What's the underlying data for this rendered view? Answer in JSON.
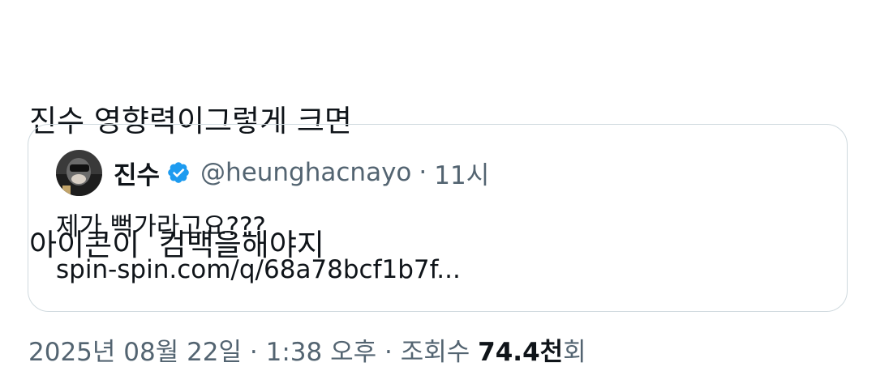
{
  "post": {
    "text_lines": [
      "진수 영향력이그렇게 크면",
      "아이콘이  컴백을해야지"
    ]
  },
  "quote": {
    "display_name": "진수",
    "verified": true,
    "handle": "@heunghacnayo",
    "separator": "·",
    "time": "11시",
    "text_lines": [
      "제가 뻑가라고요???",
      "spin-spin.com/q/68a78bcf1b7f..."
    ]
  },
  "meta": {
    "date": "2025년 08월 22일",
    "sep1": "·",
    "time": "1:38 오후",
    "sep2": "·",
    "views_label": "조회수",
    "views_count": "74.4천",
    "views_suffix": "회"
  },
  "colors": {
    "text_primary": "#0f1419",
    "text_secondary": "#536471",
    "verified_blue": "#1d9bf0",
    "card_border": "#cfd9de"
  },
  "icons": {
    "verified": "verified-badge-icon"
  }
}
